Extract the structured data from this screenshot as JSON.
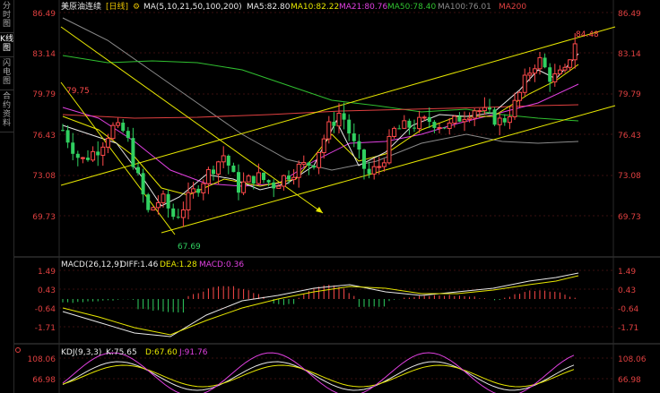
{
  "sidebar": {
    "items": [
      {
        "label": "分时图",
        "active": false
      },
      {
        "label": "K线图",
        "active": true
      },
      {
        "label": "闪电图",
        "active": false
      },
      {
        "label": "合约资料",
        "active": false
      }
    ]
  },
  "main_chart": {
    "title": "美原油连续",
    "period": "[日线]",
    "indicator_name": "MA",
    "params": "MA(5,10,21,50,100,200)",
    "ma_values": [
      {
        "label": "MA5:82.80",
        "color": "#e8e8e8"
      },
      {
        "label": "MA10:82.22",
        "color": "#e6e600"
      },
      {
        "label": "MA21:80.76",
        "color": "#e040e0"
      },
      {
        "label": "MA50:78.40",
        "color": "#30c030"
      },
      {
        "label": "MA100:76.01",
        "color": "#8a8a8a"
      },
      {
        "label": "MA200",
        "color": "#e04040"
      }
    ],
    "y_ticks": [
      "86.49",
      "83.14",
      "79.79",
      "76.43",
      "73.08",
      "69.73"
    ],
    "high_label": "84.48",
    "low_label": "67.69",
    "left_label": "79.75"
  },
  "macd": {
    "title": "MACD(26,12,9)",
    "diff": "DIFF:1.46",
    "dea": "DEA:1.28",
    "macd": "MACD:0.36",
    "y_ticks": [
      "1.49",
      "0.43",
      "-0.64",
      "-1.71"
    ]
  },
  "kdj": {
    "title": "KDJ(9,3,3)",
    "k": "K:75.65",
    "d": "D:67.60",
    "j": "J:91.76",
    "y_ticks": [
      "108.06",
      "66.98"
    ]
  },
  "colors": {
    "up": "#ff4a4a",
    "down": "#30d060",
    "channel": "#e6e600",
    "grid": "#3a1010"
  }
}
